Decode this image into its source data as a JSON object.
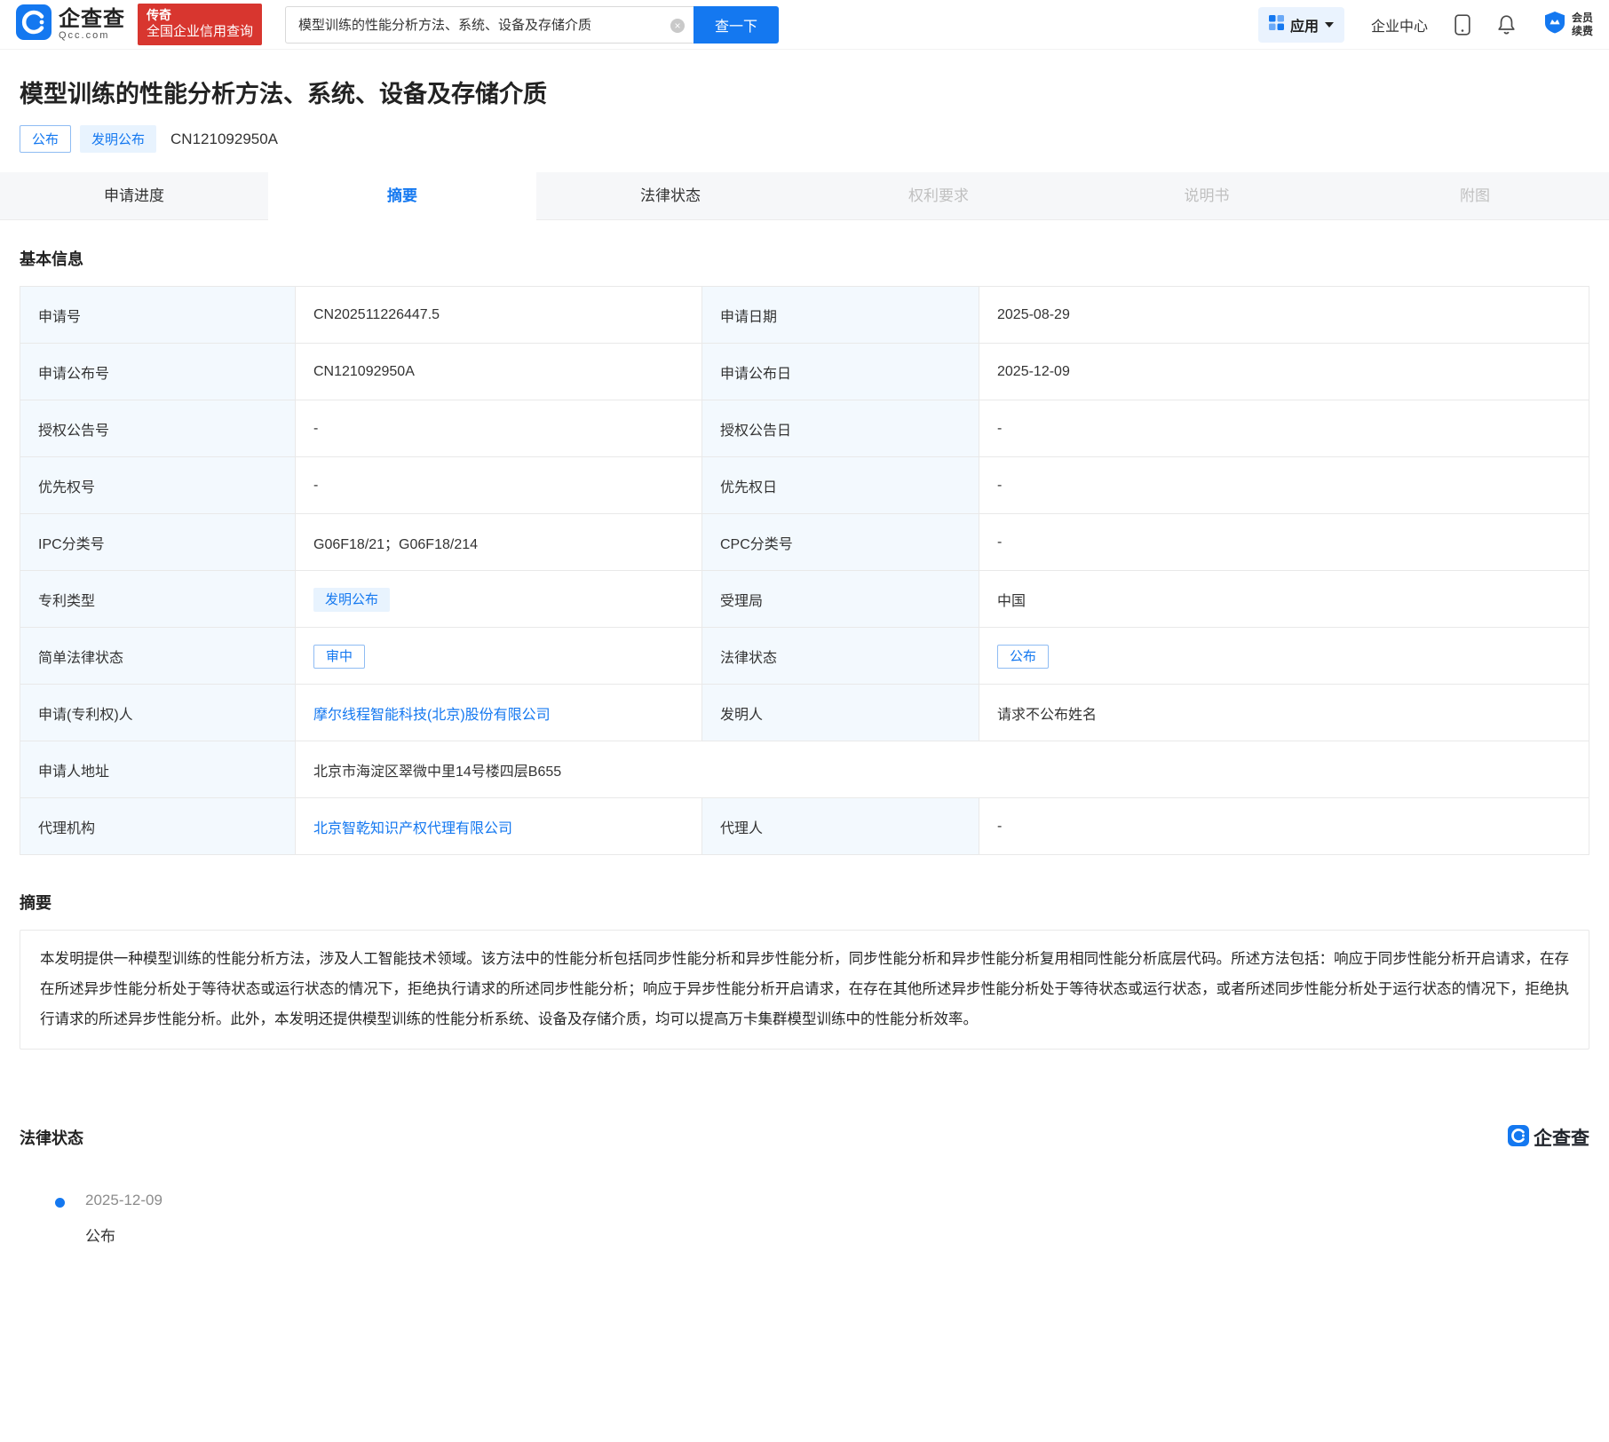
{
  "header": {
    "logo": {
      "brand": "企查查",
      "domain": "Qcc.com"
    },
    "promo": {
      "line1": "传奇",
      "line2": "全国企业信用查询"
    },
    "search": {
      "value": "模型训练的性能分析方法、系统、设备及存储介质",
      "button": "查一下"
    },
    "nav": {
      "apps": "应用",
      "enterprise_center": "企业中心",
      "vip_line1": "会员",
      "vip_line2": "续费"
    },
    "icons": {
      "clear": "×"
    }
  },
  "patent": {
    "title": "模型训练的性能分析方法、系统、设备及存储介质",
    "status_tag": "公布",
    "type_tag": "发明公布",
    "publication_no": "CN121092950A"
  },
  "tabs": [
    {
      "label": "申请进度"
    },
    {
      "label": "摘要"
    },
    {
      "label": "法律状态"
    },
    {
      "label": "权利要求"
    },
    {
      "label": "说明书"
    },
    {
      "label": "附图"
    }
  ],
  "basic_info": {
    "section_title": "基本信息",
    "rows": [
      {
        "label1": "申请号",
        "value1": "CN202511226447.5",
        "label2": "申请日期",
        "value2": "2025-08-29"
      },
      {
        "label1": "申请公布号",
        "value1": "CN121092950A",
        "label2": "申请公布日",
        "value2": "2025-12-09"
      },
      {
        "label1": "授权公告号",
        "value1": "-",
        "label2": "授权公告日",
        "value2": "-"
      },
      {
        "label1": "优先权号",
        "value1": "-",
        "label2": "优先权日",
        "value2": "-"
      },
      {
        "label1": "IPC分类号",
        "value1": "G06F18/21；G06F18/214",
        "label2": "CPC分类号",
        "value2": "-"
      },
      {
        "label1": "专利类型",
        "value1": "发明公布",
        "label2": "受理局",
        "value2": "中国"
      },
      {
        "label1": "简单法律状态",
        "value1": "审中",
        "label2": "法律状态",
        "value2": "公布"
      },
      {
        "label1": "申请(专利权)人",
        "value1": "摩尔线程智能科技(北京)股份有限公司",
        "label2": "发明人",
        "value2": "请求不公布姓名"
      },
      {
        "label1": "申请人地址",
        "value1": "北京市海淀区翠微中里14号楼四层B655"
      },
      {
        "label1": "代理机构",
        "value1": "北京智乾知识产权代理有限公司",
        "label2": "代理人",
        "value2": "-"
      }
    ]
  },
  "abstract": {
    "section_title": "摘要",
    "text": "本发明提供一种模型训练的性能分析方法，涉及人工智能技术领域。该方法中的性能分析包括同步性能分析和异步性能分析，同步性能分析和异步性能分析复用相同性能分析底层代码。所述方法包括：响应于同步性能分析开启请求，在存在所述异步性能分析处于等待状态或运行状态的情况下，拒绝执行请求的所述同步性能分析；响应于异步性能分析开启请求，在存在其他所述异步性能分析处于等待状态或运行状态，或者所述同步性能分析处于运行状态的情况下，拒绝执行请求的所述异步性能分析。此外，本发明还提供模型训练的性能分析系统、设备及存储介质，均可以提高万卡集群模型训练中的性能分析效率。"
  },
  "legal_status": {
    "section_title": "法律状态",
    "watermark_brand": "企查查",
    "items": [
      {
        "date": "2025-12-09",
        "status": "公布"
      }
    ]
  },
  "colors": {
    "brand_blue": "#1478F0",
    "promo_red": "#D8362F",
    "tag_fill_bg": "#E8F3FE",
    "label_cell_bg": "#F3F9FE",
    "link_blue": "#1478F0"
  }
}
